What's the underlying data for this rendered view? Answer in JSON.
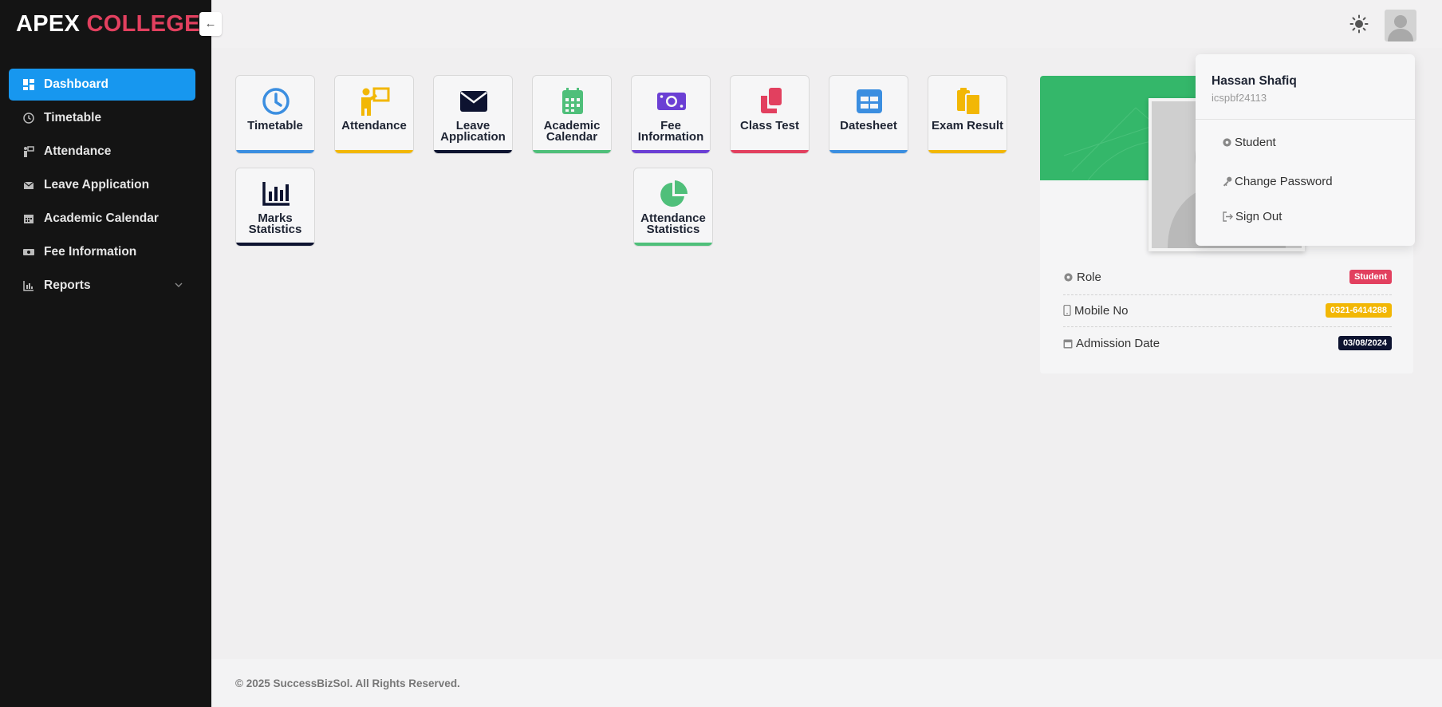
{
  "brand": {
    "word1": "APEX",
    "word2": "COLLEGE"
  },
  "sidebar": {
    "collapse_icon": "←",
    "items": [
      {
        "label": "Dashboard",
        "icon": "dashboard-icon"
      },
      {
        "label": "Timetable",
        "icon": "clock-icon"
      },
      {
        "label": "Attendance",
        "icon": "teacher-icon"
      },
      {
        "label": "Leave Application",
        "icon": "envelope-icon"
      },
      {
        "label": "Academic Calendar",
        "icon": "calendar-icon"
      },
      {
        "label": "Fee Information",
        "icon": "money-icon"
      },
      {
        "label": "Reports",
        "icon": "chart-icon"
      }
    ]
  },
  "topbar": {
    "theme_icon": "sun-icon",
    "avatar_icon": "user-avatar"
  },
  "tiles": [
    {
      "label": "Timetable",
      "icon": "clock-icon",
      "color": "#3b8ee0"
    },
    {
      "label": "Attendance",
      "icon": "teacher-icon",
      "color": "#f2b705"
    },
    {
      "label": "Leave Application",
      "icon": "envelope-icon",
      "color": "#0d1330"
    },
    {
      "label": "Academic Calendar",
      "icon": "calendar-icon",
      "color": "#4fbf7a"
    },
    {
      "label": "Fee Information",
      "icon": "money-icon",
      "color": "#6b3fd4"
    },
    {
      "label": "Class Test",
      "icon": "copy-icon",
      "color": "#e2405f"
    },
    {
      "label": "Datesheet",
      "icon": "table-icon",
      "color": "#3b8ee0"
    },
    {
      "label": "Exam Result",
      "icon": "clipboard-icon",
      "color": "#f2b705"
    },
    {
      "label": "Marks Statistics",
      "icon": "bar-chart-icon",
      "color": "#0d1330"
    },
    {
      "label": "Attendance Statistics",
      "icon": "pie-chart-icon",
      "color": "#4fbf7a"
    }
  ],
  "profile": {
    "role_label": "Role",
    "role_value": "Student",
    "mobile_label": "Mobile No",
    "mobile_value": "0321-6414288",
    "admission_label": "Admission Date",
    "admission_value": "03/08/2024"
  },
  "dropdown": {
    "name": "Hassan Shafiq",
    "username": "icspbf24113",
    "items": [
      {
        "label": "Student",
        "icon": "gear-icon"
      },
      {
        "label": "Change Password",
        "icon": "key-icon"
      },
      {
        "label": "Sign Out",
        "icon": "sign-out-icon"
      }
    ]
  },
  "footer": {
    "text": "© 2025 SuccessBizSol. All Rights Reserved."
  },
  "colors": {
    "sidebar_bg": "#141414",
    "accent_blue": "#1797ef",
    "brand_red": "#e2405f",
    "profile_green": "#34b76a",
    "badge_red": "#e2405f",
    "badge_yellow": "#f2b705",
    "badge_navy": "#0d1330"
  }
}
